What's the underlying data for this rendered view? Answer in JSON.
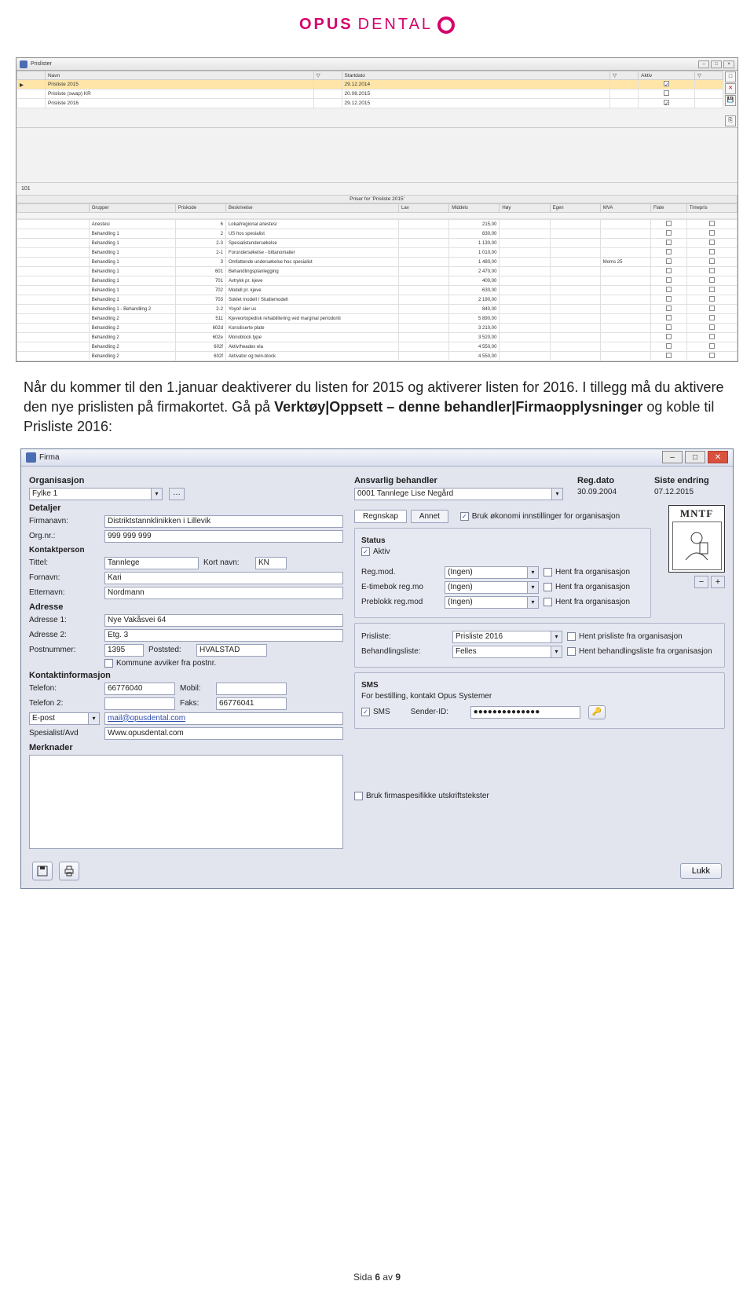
{
  "logo": {
    "part1": "OPUS",
    "part2": "DENTAL"
  },
  "win1": {
    "title": "Prislister",
    "headers": {
      "navn": "Navn",
      "startdato": "Startdato",
      "aktiv": "Aktiv"
    },
    "rows": [
      {
        "navn": "Prisliste 2015",
        "startdato": "29.12.2014",
        "aktiv": true
      },
      {
        "navn": "Prisliste (swap) KR",
        "startdato": "20.08.2015",
        "aktiv": false
      },
      {
        "navn": "Prisliste 2016",
        "startdato": "29.12.2015",
        "aktiv": true
      }
    ],
    "section_id": "101",
    "price_header": "Priser for 'Prisliste 2015'",
    "cols": {
      "grupper": "Grupper",
      "priskode": "Priskode",
      "beskrivelse": "Beskrivelse",
      "lav": "Lav",
      "middels": "Middels",
      "hoy": "Høy",
      "egen": "Egen",
      "mva": "MVA",
      "flate": "Flate",
      "timepris": "Timepris"
    },
    "prices": [
      {
        "g": "Anestesi",
        "k": "6",
        "b": "Lokal/regional anestesi",
        "m": "215,00"
      },
      {
        "g": "Behandling 1",
        "k": "2",
        "b": "US hos spesialist",
        "m": "830,00"
      },
      {
        "g": "Behandling 1",
        "k": "2-3",
        "b": "Spesialistundersøkelse",
        "m": "1 130,00"
      },
      {
        "g": "Behandling 1",
        "k": "2-1",
        "b": "Forundersøkelse - bittanomalier",
        "m": "1 010,00"
      },
      {
        "g": "Behandling 1",
        "k": "3",
        "b": "Omfattende undersøkelse hos spesialist",
        "m": "1 480,00",
        "mva": "Moms 25"
      },
      {
        "g": "Behandling 1",
        "k": "601",
        "b": "Behandlingsplanlegging",
        "m": "2 470,00"
      },
      {
        "g": "Behandling 1",
        "k": "701",
        "b": "Avtrykk pr. kjeve",
        "m": "400,00"
      },
      {
        "g": "Behandling 1",
        "k": "702",
        "b": "Modell pr. kjeve",
        "m": "630,00"
      },
      {
        "g": "Behandling 1",
        "k": "703",
        "b": "Soklet modell / Studiemodell",
        "m": "2 190,00"
      },
      {
        "g": "Behandling 1 - Behandling 2",
        "k": "2-2",
        "b": "Yoyoi! sier us",
        "m": "840,00"
      },
      {
        "g": "Behandling 2",
        "k": "511",
        "b": "Kjeveortopedisk rehabilitering ved marginal periodonti",
        "m": "5 890,00"
      },
      {
        "g": "Behandling 2",
        "k": "602d",
        "b": "Konsiliserte plate",
        "m": "3 210,00"
      },
      {
        "g": "Behandling 2",
        "k": "602e",
        "b": "Monoblock type",
        "m": "3 520,00"
      },
      {
        "g": "Behandling 2",
        "k": "602f",
        "b": "Aktiv/headex ela",
        "m": "4 550,00"
      },
      {
        "g": "Behandling 2",
        "k": "602f",
        "b": "Aktivator og twin-block",
        "m": "4 550,00"
      }
    ]
  },
  "para": {
    "t1": "Når du kommer til den 1.januar deaktiverer du listen for 2015 og aktiverer listen for 2016. I tillegg må du aktivere den nye prislisten på firmakortet. Gå på ",
    "b1": "Verktøy|Oppsett – denne behandler|Firmaopplysninger",
    "t2": " og koble til Prisliste 2016:"
  },
  "win2": {
    "title": "Firma",
    "org_label": "Organisasjon",
    "org_value": "Fylke 1",
    "ansvarlig_label": "Ansvarlig behandler",
    "ansvarlig_value": "0001 Tannlege Lise Negård",
    "regdato_label": "Reg.dato",
    "regdato": "30.09.2004",
    "siste_label": "Siste endring",
    "siste": "07.12.2015",
    "detaljer": "Detaljer",
    "firmanavn_l": "Firmanavn:",
    "firmanavn": "Distriktstannklinikken i Lillevik",
    "orgnr_l": "Org.nr.:",
    "orgnr": "999 999 999",
    "kontaktperson": "Kontaktperson",
    "tittel_l": "Tittel:",
    "tittel": "Tannlege",
    "kortnavn_l": "Kort navn:",
    "kortnavn": "KN",
    "fornavn_l": "Fornavn:",
    "fornavn": "Kari",
    "etternavn_l": "Etternavn:",
    "etternavn": "Nordmann",
    "adresse": "Adresse",
    "adr1_l": "Adresse 1:",
    "adr1": "Nye Vakåsvei 64",
    "adr2_l": "Adresse 2:",
    "adr2": "Etg. 3",
    "postnr_l": "Postnummer:",
    "postnr": "1395",
    "poststed_l": "Poststed:",
    "poststed": "HVALSTAD",
    "kommune_chk": "Kommune avviker fra postnr.",
    "kontaktinfo": "Kontaktinformasjon",
    "tlf_l": "Telefon:",
    "tlf": "66776040",
    "mobil_l": "Mobil:",
    "mobil": "",
    "tlf2_l": "Telefon 2:",
    "tlf2": "",
    "faks_l": "Faks:",
    "faks": "66776041",
    "epost_l": "E-post",
    "epost": "mail@opusdental.com",
    "spes_l": "Spesialist/Avd",
    "spes": "Www.opusdental.com",
    "merknader": "Merknader",
    "tab1": "Regnskap",
    "tab2": "Annet",
    "bruk_okonomi": "Bruk økonomi innstillinger for organisasjon",
    "status": "Status",
    "aktiv": "Aktiv",
    "regmod_l": "Reg.mod.",
    "ingen": "(Ingen)",
    "hent_org": "Hent fra organisasjon",
    "etime_l": "E-timebok reg.mo",
    "preblokk_l": "Preblokk reg.mod",
    "prisliste_l": "Prisliste:",
    "prisliste": "Prisliste 2016",
    "hent_pris": "Hent prisliste fra organisasjon",
    "behliste_l": "Behandlingsliste:",
    "behliste": "Felles",
    "hent_beh": "Hent behandlingsliste fra organisasjon",
    "sms": "SMS",
    "sms_info": "For bestilling, kontakt Opus Systemer",
    "sms_chk": "SMS",
    "sender_l": "Sender-ID:",
    "sender": "●●●●●●●●●●●●●●",
    "bruk_firma_chk": "Bruk firmaspesifikke utskriftstekster",
    "mntf": "MNTF",
    "lukk": "Lukk"
  },
  "footer": {
    "prefix": "Sida ",
    "page": "6",
    "mid": " av ",
    "total": "9"
  }
}
